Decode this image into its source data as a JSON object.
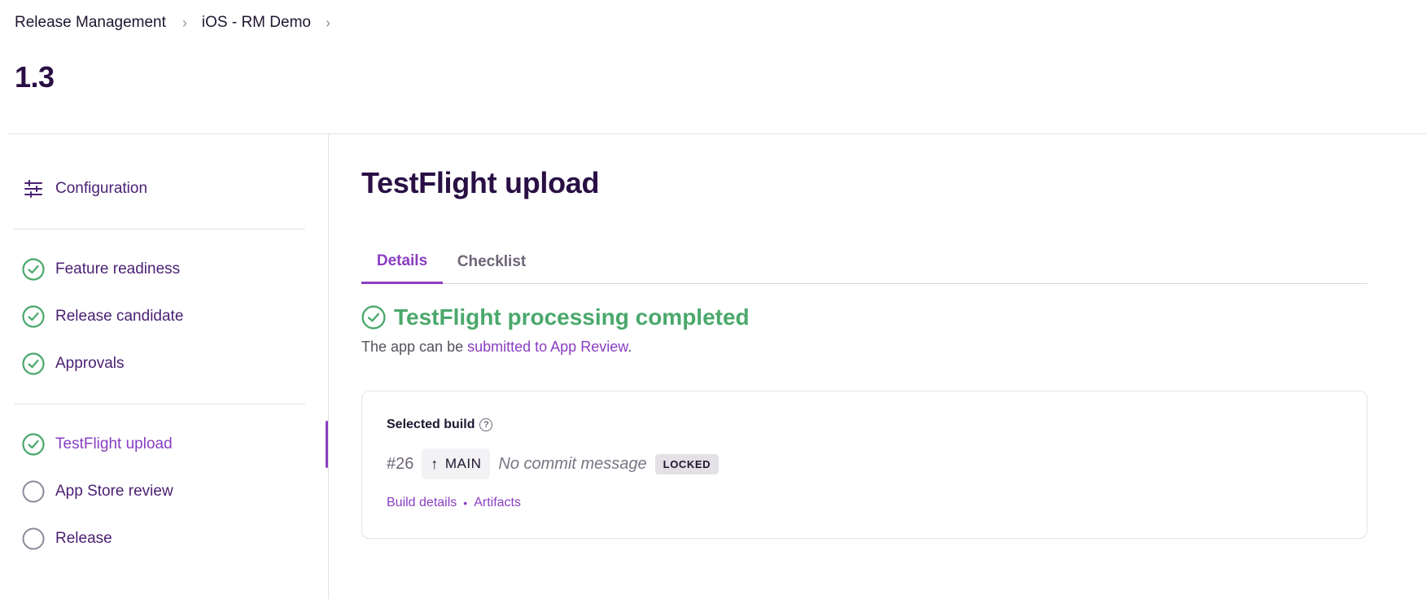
{
  "breadcrumb": {
    "items": [
      "Release Management",
      "iOS - RM Demo"
    ],
    "separator": "›"
  },
  "version": "1.3",
  "sidebar": {
    "config_label": "Configuration",
    "steps_group1": [
      {
        "label": "Feature readiness",
        "status": "completed"
      },
      {
        "label": "Release candidate",
        "status": "completed"
      },
      {
        "label": "Approvals",
        "status": "completed"
      }
    ],
    "steps_group2": [
      {
        "label": "TestFlight upload",
        "status": "completed",
        "active": true
      },
      {
        "label": "App Store review",
        "status": "pending"
      },
      {
        "label": "Release",
        "status": "pending"
      }
    ]
  },
  "main": {
    "title": "TestFlight upload",
    "tabs": [
      {
        "label": "Details",
        "active": true
      },
      {
        "label": "Checklist",
        "active": false
      }
    ],
    "status": "TestFlight processing completed",
    "description_prefix": "The app can be ",
    "description_link": "submitted to App Review",
    "description_suffix": ".",
    "card": {
      "label": "Selected build",
      "help_glyph": "?",
      "build_number": "#26",
      "branch": "MAIN",
      "commit_message": "No commit message",
      "badge": "LOCKED",
      "links": [
        "Build details",
        "Artifacts"
      ],
      "link_separator": "•"
    }
  },
  "colors": {
    "accent": "#8a3ec2",
    "success": "#4aa86b",
    "heading": "#2a0f45",
    "nav_text": "#4a1f72"
  }
}
